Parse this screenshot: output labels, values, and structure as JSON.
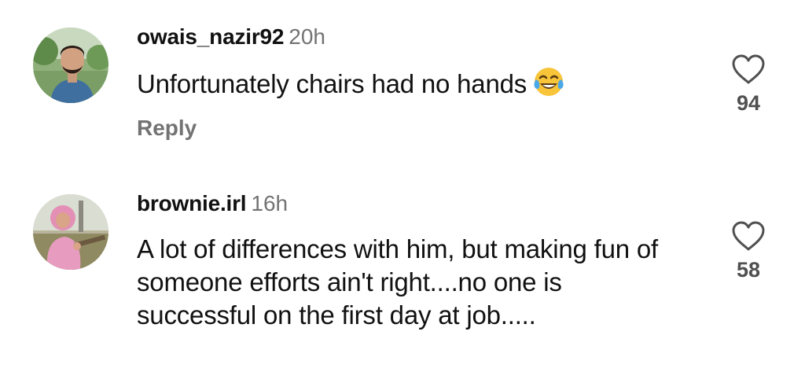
{
  "comments": [
    {
      "username": "owais_nazir92",
      "time": "20h",
      "text": "Unfortunately chairs had no hands",
      "emoji": "face-with-tears-of-joy",
      "reply_label": "Reply",
      "likes": "94"
    },
    {
      "username": "brownie.irl",
      "time": "16h",
      "text": "A lot of differences with him, but making fun of someone efforts ain't right....no one is successful on the first day at job.....",
      "likes": "58"
    }
  ],
  "colors": {
    "text_primary": "#111111",
    "text_secondary": "#737373",
    "heart_outline": "#505050",
    "background": "#ffffff"
  }
}
